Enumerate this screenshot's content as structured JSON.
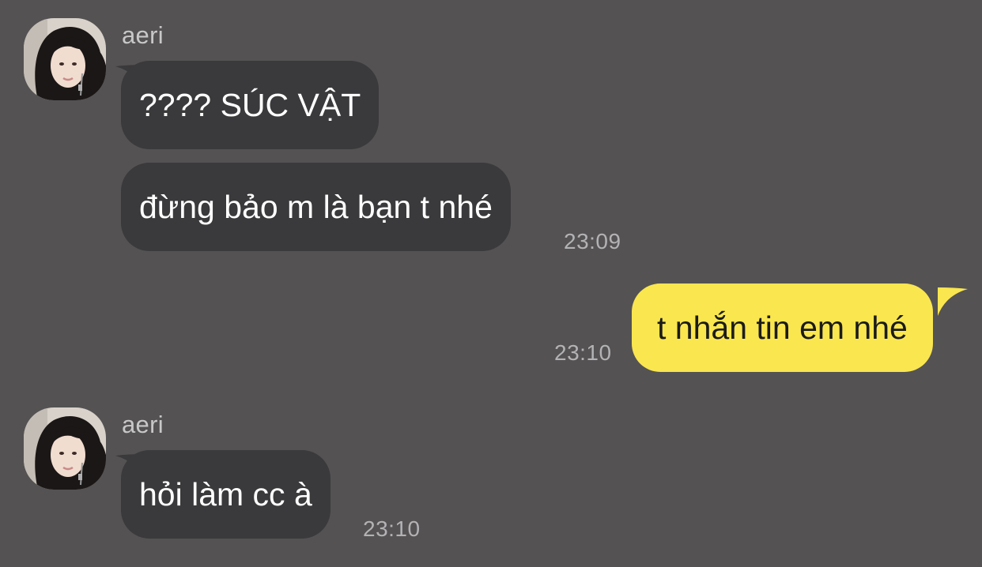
{
  "colors": {
    "background": "#545253",
    "incoming_bubble": "#3a393b",
    "outgoing_bubble": "#fae64f",
    "timestamp": "#b3b2b4"
  },
  "messages": [
    {
      "sender": "aeri",
      "avatar_icon": "profile-photo-icon",
      "bubbles": [
        "???? SÚC VẬT",
        "đừng bảo m là bạn t nhé"
      ],
      "time": "23:09"
    },
    {
      "sender": "me",
      "bubbles": [
        "t nhắn tin em nhé"
      ],
      "time": "23:10"
    },
    {
      "sender": "aeri",
      "avatar_icon": "profile-photo-icon",
      "bubbles": [
        "hỏi làm cc à"
      ],
      "time": "23:10"
    }
  ]
}
